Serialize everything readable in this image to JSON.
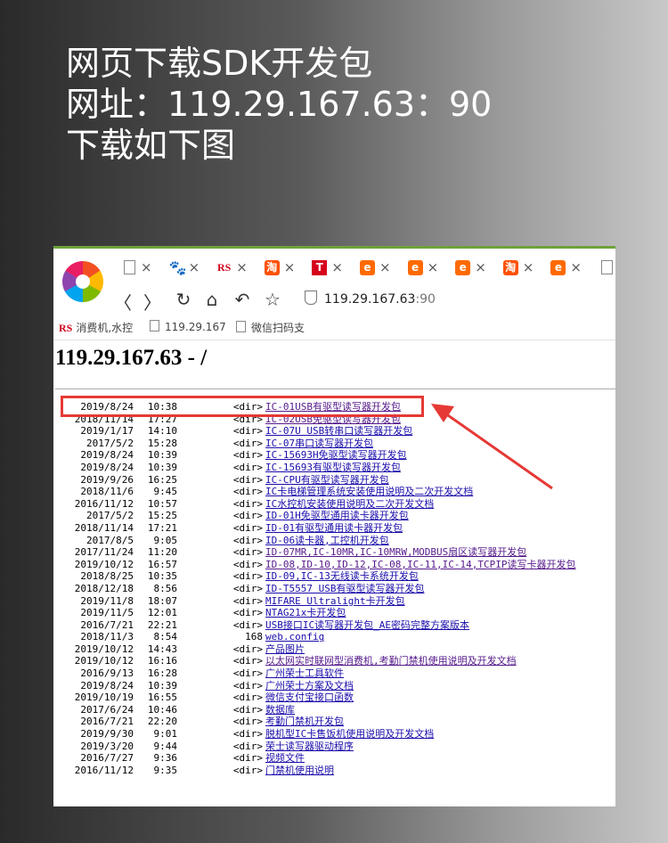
{
  "headline": [
    "网页下载SDK开发包",
    "网址：119.29.167.63：90",
    "下载如下图"
  ],
  "tabs": [
    {
      "icon": "doc-icon",
      "close": "×"
    },
    {
      "icon": "baidu-paw-icon",
      "close": "×"
    },
    {
      "icon": "rs-icon",
      "label": "RS",
      "close": "×"
    },
    {
      "icon": "taobao-icon",
      "label": "淘",
      "close": "×"
    },
    {
      "icon": "tmall-icon",
      "label": "T",
      "close": "×"
    },
    {
      "icon": "alibaba-icon",
      "label": "e",
      "close": "×"
    },
    {
      "icon": "alibaba-icon",
      "label": "e",
      "close": "×"
    },
    {
      "icon": "alibaba-icon",
      "label": "e",
      "close": "×"
    },
    {
      "icon": "taobao-icon",
      "label": "淘",
      "close": "×"
    },
    {
      "icon": "alibaba-icon",
      "label": "e",
      "close": "×"
    },
    {
      "icon": "doc-icon"
    }
  ],
  "nav": {
    "back": "〈",
    "forward": "〉",
    "reload": "↻",
    "home": "⌂",
    "undo": "↶",
    "star": "☆"
  },
  "address": {
    "host": "119.29.167.63",
    "port": ":90"
  },
  "bookmarks": [
    {
      "icon": "RS",
      "label": "消费机,水控"
    },
    {
      "icon": "doc",
      "label": "119.29.167"
    },
    {
      "icon": "doc",
      "label": "微信扫码支"
    }
  ],
  "page_title_host": "119.29.167.63",
  "page_title_rest": " - /",
  "entries": [
    {
      "date": "2019/8/24",
      "time": "10:38",
      "size": "<dir>",
      "name": "IC-01USB有驱型读写器开发包",
      "visited": true
    },
    {
      "date": "2018/11/14",
      "time": "17:27",
      "size": "<dir>",
      "name": "IC-02USB免驱型读写器开发包",
      "visited": true
    },
    {
      "date": "2019/1/17",
      "time": "14:10",
      "size": "<dir>",
      "name": "IC-07U USB转串口读写器开发包"
    },
    {
      "date": "2017/5/2",
      "time": "15:28",
      "size": "<dir>",
      "name": "IC-07串口读写器开发包"
    },
    {
      "date": "2019/8/24",
      "time": "10:39",
      "size": "<dir>",
      "name": "IC-15693H免驱型读写器开发包"
    },
    {
      "date": "2019/8/24",
      "time": "10:39",
      "size": "<dir>",
      "name": "IC-15693有驱型读写器开发包"
    },
    {
      "date": "2019/9/26",
      "time": "16:25",
      "size": "<dir>",
      "name": "IC-CPU有驱型读写器开发包"
    },
    {
      "date": "2018/11/6",
      "time": "9:45",
      "size": "<dir>",
      "name": "IC卡电梯管理系统安装使用说明及二次开发文档"
    },
    {
      "date": "2016/11/12",
      "time": "10:57",
      "size": "<dir>",
      "name": "IC水控机安装使用说明及二次开发文档"
    },
    {
      "date": "2017/5/2",
      "time": "15:25",
      "size": "<dir>",
      "name": "ID-01H免驱型通用读卡器开发包"
    },
    {
      "date": "2018/11/14",
      "time": "17:21",
      "size": "<dir>",
      "name": "ID-01有驱型通用读卡器开发包"
    },
    {
      "date": "2017/8/5",
      "time": "9:05",
      "size": "<dir>",
      "name": "ID-06读卡器,工控机开发包"
    },
    {
      "date": "2017/11/24",
      "time": "11:20",
      "size": "<dir>",
      "name": "ID-07MR,IC-10MR,IC-10MRW,MODBUS扇区读写器开发包",
      "visited": true
    },
    {
      "date": "2019/10/12",
      "time": "16:57",
      "size": "<dir>",
      "name": "ID-08,ID-10,ID-12,IC-08,IC-11,IC-14,TCPIP读写卡器开发包",
      "visited": true
    },
    {
      "date": "2018/8/25",
      "time": "10:35",
      "size": "<dir>",
      "name": "ID-09,IC-13无线读卡系统开发包"
    },
    {
      "date": "2018/12/18",
      "time": "8:56",
      "size": "<dir>",
      "name": "ID-T5557 USB有驱型读写器开发包"
    },
    {
      "date": "2019/11/8",
      "time": "18:07",
      "size": "<dir>",
      "name": "MIFARE Ultralight卡开发包"
    },
    {
      "date": "2019/11/5",
      "time": "12:01",
      "size": "<dir>",
      "name": "NTAG21x卡开发包"
    },
    {
      "date": "2016/7/21",
      "time": "22:21",
      "size": "<dir>",
      "name": "USB接口IC读写器开发包_AE密码完整方案版本"
    },
    {
      "date": "2018/11/3",
      "time": "8:54",
      "size": "168",
      "name": "web.config"
    },
    {
      "date": "2019/10/12",
      "time": "14:43",
      "size": "<dir>",
      "name": "产品图片"
    },
    {
      "date": "2019/10/12",
      "time": "16:16",
      "size": "<dir>",
      "name": "以太网实时联网型消费机,考勤门禁机使用说明及开发文档",
      "visited": true
    },
    {
      "date": "2016/9/13",
      "time": "16:28",
      "size": "<dir>",
      "name": "广州荣士工具软件"
    },
    {
      "date": "2019/8/24",
      "time": "10:39",
      "size": "<dir>",
      "name": "广州荣士方案及文档"
    },
    {
      "date": "2019/10/19",
      "time": "16:55",
      "size": "<dir>",
      "name": "微信支付宝接口函数"
    },
    {
      "date": "2017/6/24",
      "time": "10:46",
      "size": "<dir>",
      "name": "数据库"
    },
    {
      "date": "2016/7/21",
      "time": "22:20",
      "size": "<dir>",
      "name": "考勤门禁机开发包"
    },
    {
      "date": "2019/9/30",
      "time": "9:01",
      "size": "<dir>",
      "name": "脱机型IC卡售饭机使用说明及开发文档"
    },
    {
      "date": "2019/3/20",
      "time": "9:44",
      "size": "<dir>",
      "name": "荣士读写器驱动程序"
    },
    {
      "date": "2016/7/27",
      "time": "9:36",
      "size": "<dir>",
      "name": "视频文件"
    },
    {
      "date": "2016/11/12",
      "time": "9:35",
      "size": "<dir>",
      "name": "门禁机使用说明"
    }
  ]
}
